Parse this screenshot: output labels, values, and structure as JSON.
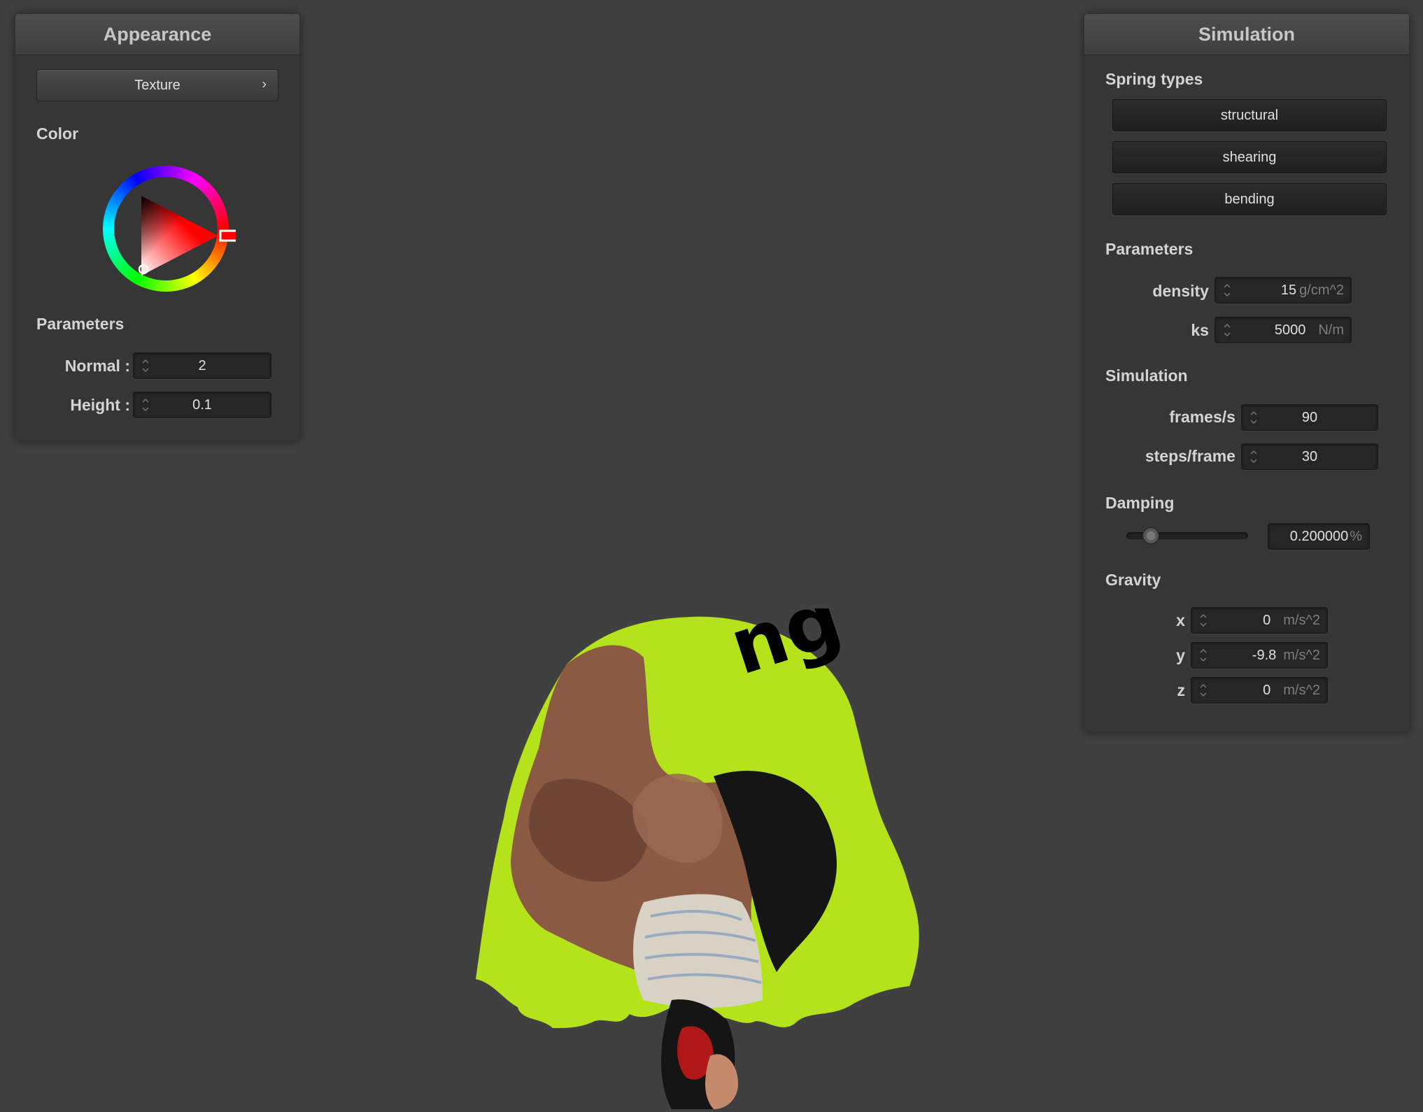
{
  "appearance": {
    "title": "Appearance",
    "texture_button": "Texture",
    "color_label": "Color",
    "parameters_label": "Parameters",
    "normal_label": "Normal :",
    "normal_value": "2",
    "height_label": "Height :",
    "height_value": "0.1",
    "selected_color": "#ff0000"
  },
  "simulation_panel": {
    "title": "Simulation",
    "spring_types_label": "Spring types",
    "spring_buttons": [
      "structural",
      "shearing",
      "bending"
    ],
    "parameters_label": "Parameters",
    "density_label": "density :",
    "density_value": "15",
    "density_unit": "g/cm^2",
    "ks_label": "ks :",
    "ks_value": "5000",
    "ks_unit": "N/m",
    "simulation_label": "Simulation",
    "fps_label": "frames/s :",
    "fps_value": "90",
    "steps_label": "steps/frame :",
    "steps_value": "30",
    "damping_label": "Damping",
    "damping_value": "0.200000",
    "damping_unit": "%",
    "damping_fraction": 0.2,
    "gravity_label": "Gravity",
    "gx_label": "x :",
    "gx_value": "0",
    "gy_label": "y :",
    "gy_value": "-9.8",
    "gz_label": "z :",
    "gz_value": "0",
    "g_unit": "m/s^2"
  },
  "viewport": {
    "cloth_text": "ng",
    "cloth_color": "#b4e31c"
  }
}
